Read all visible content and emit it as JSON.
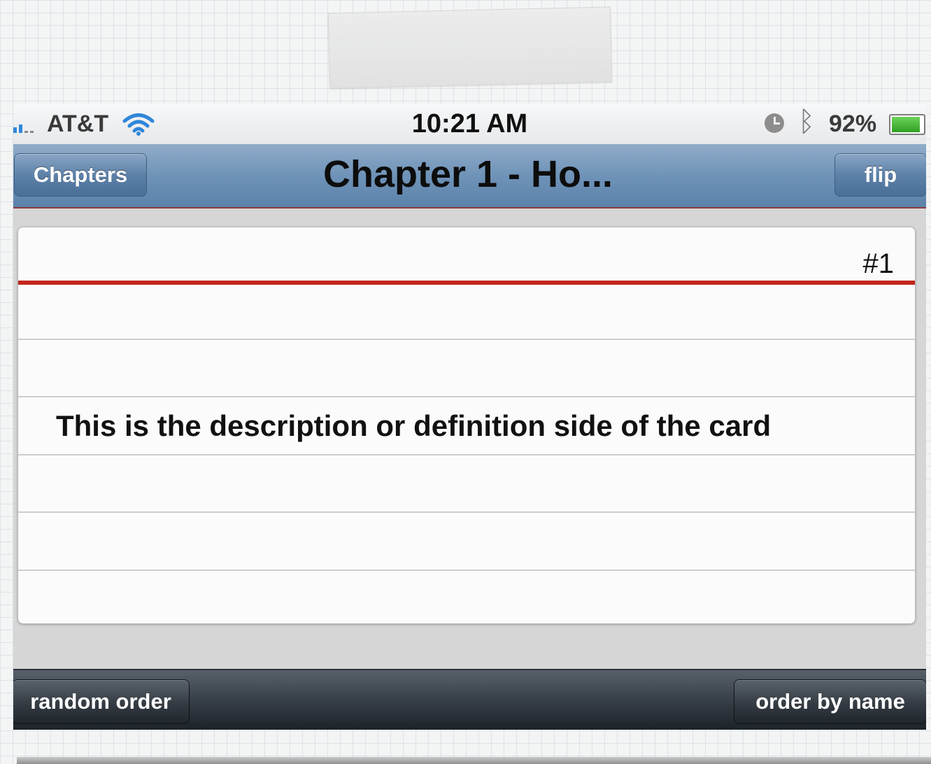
{
  "status_bar": {
    "carrier": "AT&T",
    "time": "10:21 AM",
    "battery_percent_label": "92%",
    "battery_level": 0.92,
    "icons": [
      "signal-icon",
      "wifi-icon",
      "alarm-clock-icon",
      "bluetooth-icon",
      "battery-icon"
    ]
  },
  "nav_bar": {
    "back_label": "Chapters",
    "title": "Chapter 1 - Ho...",
    "flip_label": "flip",
    "tint_color": "#6f93b8"
  },
  "card": {
    "number": "#1",
    "text": "This is the description or definition side of the card",
    "margin_line_color": "#c0271d"
  },
  "toolbar": {
    "random_label": "random order",
    "name_label": "order by name"
  }
}
